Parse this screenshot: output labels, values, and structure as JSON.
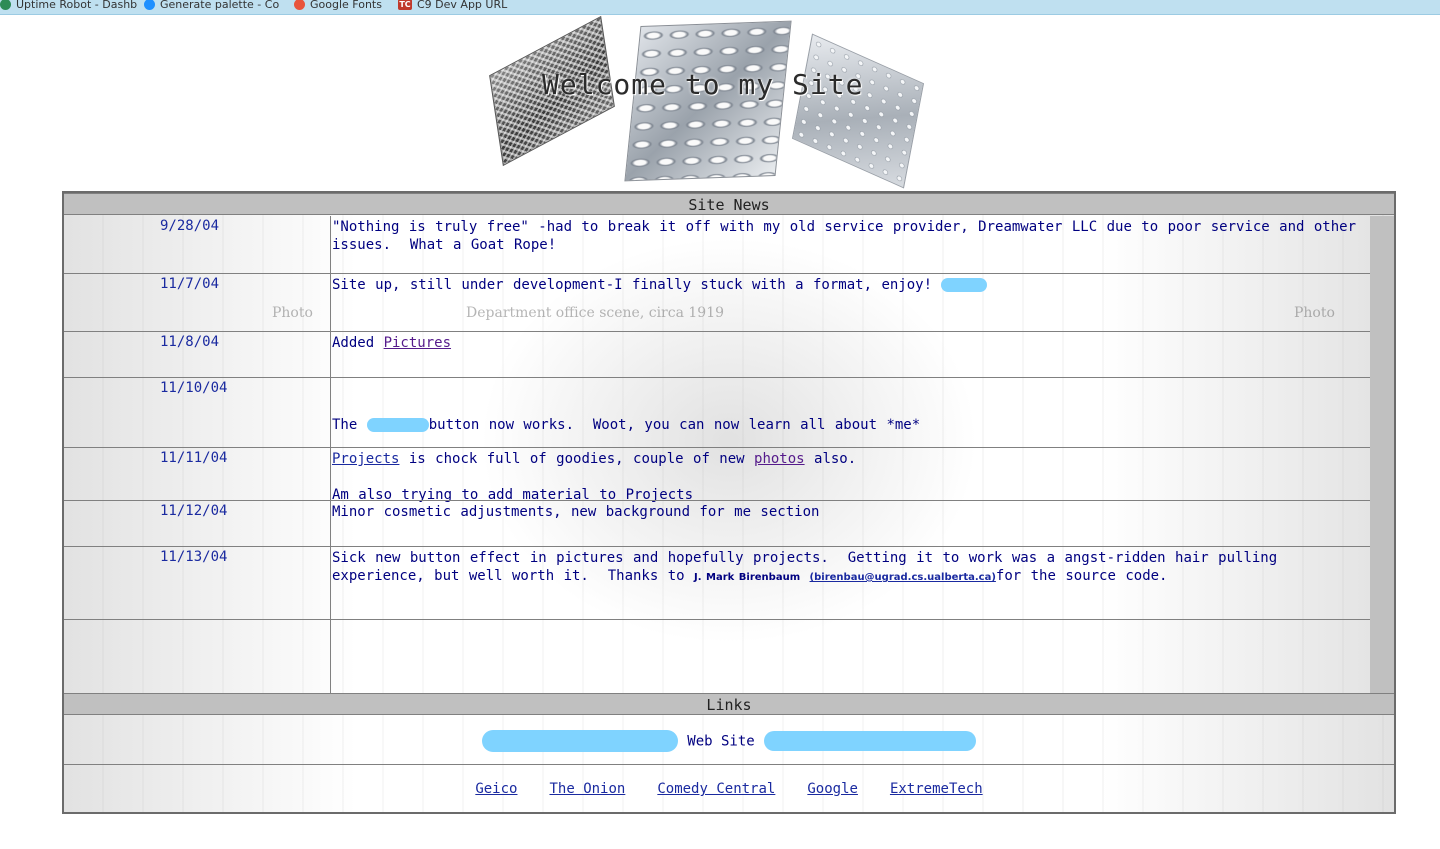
{
  "bookmarks": [
    {
      "label": "Uptime Robot - Dashb",
      "icon": "uptime-robot-icon",
      "color": "#2e8b57"
    },
    {
      "label": "Generate palette - Co",
      "icon": "palette-icon",
      "color": "#1e90ff"
    },
    {
      "label": "Google Fonts",
      "icon": "google-fonts-icon",
      "color": "#e8553d"
    },
    {
      "label": "C9 Dev App URL",
      "icon": "tc-icon",
      "color": "#c0392b"
    }
  ],
  "banner": {
    "title": "Welcome to my Site"
  },
  "news": {
    "header": "Site News",
    "rows": [
      {
        "date": "9/28/04",
        "text": "\"Nothing is truly free\" -had to break it off with my old service provider, Dreamwater LLC due to poor service and other issues.  What a Goat Rope!"
      },
      {
        "date": "11/7/04",
        "text": "Site up, still under development-I finally stuck with a format, enjoy!"
      },
      {
        "date": "11/8/04",
        "text_before": "Added ",
        "link": "Pictures"
      },
      {
        "date": "11/10/04",
        "text_a_start": "The ",
        "text_a_end": "button now works.  Woot, you can now learn all about *me*",
        "text_b": "Am also trying to add material to Projects"
      },
      {
        "date": "11/11/04",
        "link1": "Projects",
        "mid": " is chock full of goodies, couple of new ",
        "link2": "photos",
        "end": " also."
      },
      {
        "date": "11/12/04",
        "text": "Minor cosmetic adjustments, new background for me section"
      },
      {
        "date": "11/13/04",
        "text_start": "Sick new button effect in pictures and hopefully projects.  Getting it to work was a angst-ridden hair pulling experience, but well worth it.  Thanks to ",
        "credit_name": "J. Mark Birenbaum",
        "credit_email": "(birenbau@ugrad.cs.ualberta.ca)",
        "text_end": "for the source code."
      }
    ]
  },
  "background_captions": {
    "left": "Photo",
    "center": "Department office scene, circa 1919",
    "right": "Photo"
  },
  "links": {
    "header": "Links",
    "website_label": "Web Site",
    "items": [
      "Geico",
      "The Onion",
      "Comedy Central",
      "Google",
      "ExtremeTech"
    ]
  },
  "colors": {
    "header_gray": "#c0c0c0",
    "text_navy": "#000080",
    "link_blue": "#1a2aa0",
    "visited_purple": "#551a8b",
    "redaction_blue": "#7fd3ff"
  }
}
